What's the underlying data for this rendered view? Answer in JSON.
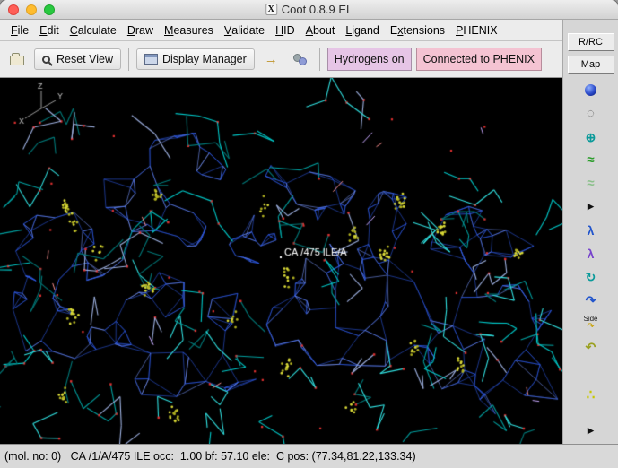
{
  "window": {
    "title": "Coot 0.8.9 EL",
    "icon_glyph": "X"
  },
  "menu": {
    "items": [
      {
        "label": "File",
        "mnemonic_index": 0
      },
      {
        "label": "Edit",
        "mnemonic_index": 0
      },
      {
        "label": "Calculate",
        "mnemonic_index": 0
      },
      {
        "label": "Draw",
        "mnemonic_index": 0
      },
      {
        "label": "Measures",
        "mnemonic_index": 0
      },
      {
        "label": "Validate",
        "mnemonic_index": 0
      },
      {
        "label": "HID",
        "mnemonic_index": 0
      },
      {
        "label": "About",
        "mnemonic_index": 0
      },
      {
        "label": "Ligand",
        "mnemonic_index": 0
      },
      {
        "label": "Extensions",
        "mnemonic_index": 1
      },
      {
        "label": "PHENIX",
        "mnemonic_index": 0
      }
    ]
  },
  "toolbar": {
    "reset_view_label": "Reset View",
    "display_manager_label": "Display Manager",
    "hydrogens_label": "Hydrogens on",
    "phenix_label": "Connected to PHENIX"
  },
  "sidebar": {
    "rrc_label": "R/RC",
    "map_label": "Map",
    "icons": [
      {
        "name": "blue-sphere-icon",
        "type": "sphere"
      },
      {
        "name": "dotted-circle-icon",
        "type": "glyph",
        "glyph": "◌",
        "color": "#5a5a5a",
        "size": 15
      },
      {
        "name": "rigid-body-fit-icon",
        "type": "glyph",
        "glyph": "⊕",
        "color": "#0a9a9a",
        "size": 14
      },
      {
        "name": "real-space-refine-icon",
        "type": "glyph",
        "glyph": "≈",
        "color": "#2e9e2e",
        "size": 15
      },
      {
        "name": "regularize-zone-icon",
        "type": "glyph",
        "glyph": "≈",
        "color": "#8cc08c",
        "size": 15
      },
      {
        "name": "expander-icon",
        "type": "glyph",
        "glyph": "▶",
        "color": "#111111",
        "size": 9
      },
      {
        "name": "rotamers-icon",
        "type": "glyph",
        "glyph": "λ",
        "color": "#2255cc",
        "size": 14
      },
      {
        "name": "auto-fit-rotamer-icon",
        "type": "glyph",
        "glyph": "λ",
        "color": "#7744cc",
        "size": 14
      },
      {
        "name": "rotate-translate-icon",
        "type": "glyph",
        "glyph": "↻",
        "color": "#0a9a9a",
        "size": 14
      },
      {
        "name": "flip-peptide-icon",
        "type": "glyph",
        "glyph": "↷",
        "color": "#2255cc",
        "size": 14
      },
      {
        "name": "side-chain-flip-icon",
        "type": "side",
        "label": "Side",
        "color": "#c8a000"
      },
      {
        "name": "jed-flip-icon",
        "type": "glyph",
        "glyph": "↶",
        "color": "#9aa020",
        "size": 14
      },
      {
        "name": "add-alt-conf-icon",
        "type": "glyph",
        "glyph": "∴",
        "color": "#c8c800",
        "size": 15,
        "gap_before": true
      },
      {
        "name": "bottom-expander-icon",
        "type": "glyph",
        "glyph": "▶",
        "color": "#111111",
        "size": 9,
        "push_bottom": true
      }
    ]
  },
  "viewport": {
    "atom_label": "CA /475 ILE/A",
    "axes": [
      "X",
      "Y",
      "Z"
    ],
    "colors": {
      "mesh_blue": "#2d5ae6",
      "mesh_light": "#7896ff",
      "sticks_cyan": "#00c8c8",
      "dots_yellow": "#d8d838",
      "atoms_red": "#e03030",
      "label_white": "#ffffff"
    }
  },
  "statusbar": {
    "text": "(mol. no: 0)   CA /1/A/475 ILE occ:  1.00 bf: 57.10 ele:  C pos: (77.34,81.22,133.34)"
  }
}
